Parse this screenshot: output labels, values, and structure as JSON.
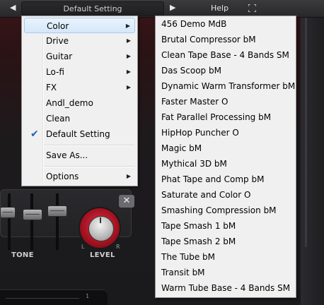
{
  "topbar": {
    "preset_name": "Default Setting",
    "help_label": "Help"
  },
  "controls": {
    "tone_label": "TONE",
    "level_label": "LEVEL",
    "knob_left_label": "L",
    "knob_right_label": "R",
    "close_label": "✕",
    "scale_value": "1"
  },
  "main_menu": {
    "items": [
      {
        "label": "Color",
        "submenu": true
      },
      {
        "label": "Drive",
        "submenu": true
      },
      {
        "label": "Guitar",
        "submenu": true
      },
      {
        "label": "Lo-fi",
        "submenu": true
      },
      {
        "label": "FX",
        "submenu": true
      },
      {
        "label": "Andl_demo",
        "submenu": false
      },
      {
        "label": "Clean",
        "submenu": false
      },
      {
        "label": "Default Setting",
        "submenu": false,
        "checked": true
      },
      {
        "label": "Save As...",
        "submenu": false
      },
      {
        "label": "Options",
        "submenu": true
      }
    ],
    "check_glyph": "✔",
    "arrow_glyph": "▶"
  },
  "color_submenu": {
    "items": [
      "456 Demo MdB",
      "Brutal Compressor bM",
      "Clean Tape Base - 4 Bands SM",
      "Das Scoop bM",
      "Dynamic Warm Transformer bM",
      "Faster Master O",
      "Fat Parallel Processing bM",
      "HipHop Puncher O",
      "Magic bM",
      "Mythical 3D bM",
      "Phat Tape and Comp bM",
      "Saturate and Color O",
      "Smashing Compression bM",
      "Tape Smash 1 bM",
      "Tape Smash 2 bM",
      "The Tube bM",
      "Transit bM",
      "Warm Tube Base - 4 Bands SM"
    ]
  },
  "colors": {
    "menu_bg": "#f0f0f0",
    "highlight": "#d4e7fa",
    "accent_red": "#a3111f"
  },
  "icons": {
    "prev": "prev-preset-icon",
    "next": "next-preset-icon",
    "fullscreen": "fullscreen-icon",
    "check": "checkmark-icon",
    "submenu": "submenu-arrow-icon"
  }
}
